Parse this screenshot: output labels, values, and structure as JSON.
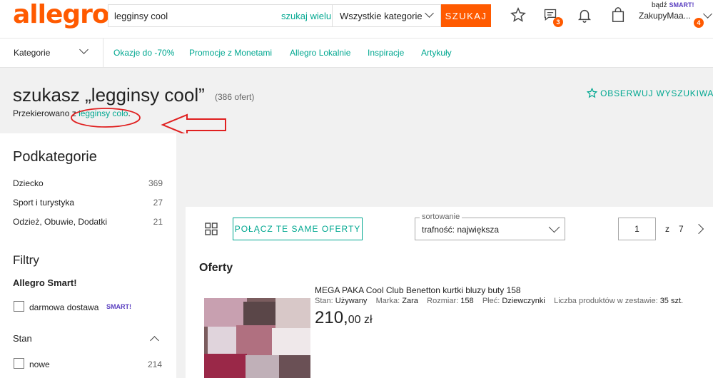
{
  "header": {
    "logo": "allegro",
    "search_value": "legginsy cool",
    "search_many": "szukaj wielu",
    "category": "Wszystkie kategorie",
    "search_button": "SZUKAJ",
    "messages_badge": "3",
    "user_badge": "4",
    "smart_prefix": "bądź",
    "smart_label": "SMART!",
    "user_name": "ZakupyMaa..."
  },
  "nav": {
    "categories": "Kategorie",
    "links": [
      "Okazje do -70%",
      "Promocje z Monetami",
      "Allegro Lokalnie",
      "Inspiracje",
      "Artykuły"
    ]
  },
  "results": {
    "title": "szukasz „legginsy cool”",
    "count": "(386 ofert)",
    "redirect_prefix": "Przekierowano z",
    "redirect_link": "legginsy colo",
    "redirect_suffix": ".",
    "observe": "OBSERWUJ WYSZUKIWAN"
  },
  "sidebar": {
    "subcategories_title": "Podkategorie",
    "subcategories": [
      {
        "label": "Dziecko",
        "count": "369"
      },
      {
        "label": "Sport i turystyka",
        "count": "27"
      },
      {
        "label": "Odzież, Obuwie, Dodatki",
        "count": "21"
      }
    ],
    "filters_title": "Filtry",
    "smart_title": "Allegro Smart!",
    "free_delivery": "darmowa dostawa",
    "smart_badge": "SMART!",
    "condition_title": "Stan",
    "condition_new": "nowe",
    "condition_new_count": "214"
  },
  "toolbar": {
    "merge_button": "POŁĄCZ TE SAME OFERTY",
    "sort_legend": "sortowanie",
    "sort_value": "trafność: największa",
    "page_current": "1",
    "page_of": "z",
    "page_total": "7"
  },
  "offers": {
    "title": "Oferty",
    "items": [
      {
        "title": "MEGA PAKA Cool Club Benetton kurtki bluzy buty 158",
        "condition_label": "Stan:",
        "condition": "Używany",
        "brand_label": "Marka:",
        "brand": "Zara",
        "size_label": "Rozmiar:",
        "size": "158",
        "gender_label": "Płeć:",
        "gender": "Dziewczynki",
        "set_label": "Liczba produktów w zestawie:",
        "set_count": "35 szt.",
        "price_main": "210,",
        "price_cents": "00 zł"
      }
    ]
  },
  "colors": {
    "brand": "#ff5a00",
    "link": "#00a790",
    "smart": "#5a3fc0",
    "annotation": "#e02020"
  }
}
